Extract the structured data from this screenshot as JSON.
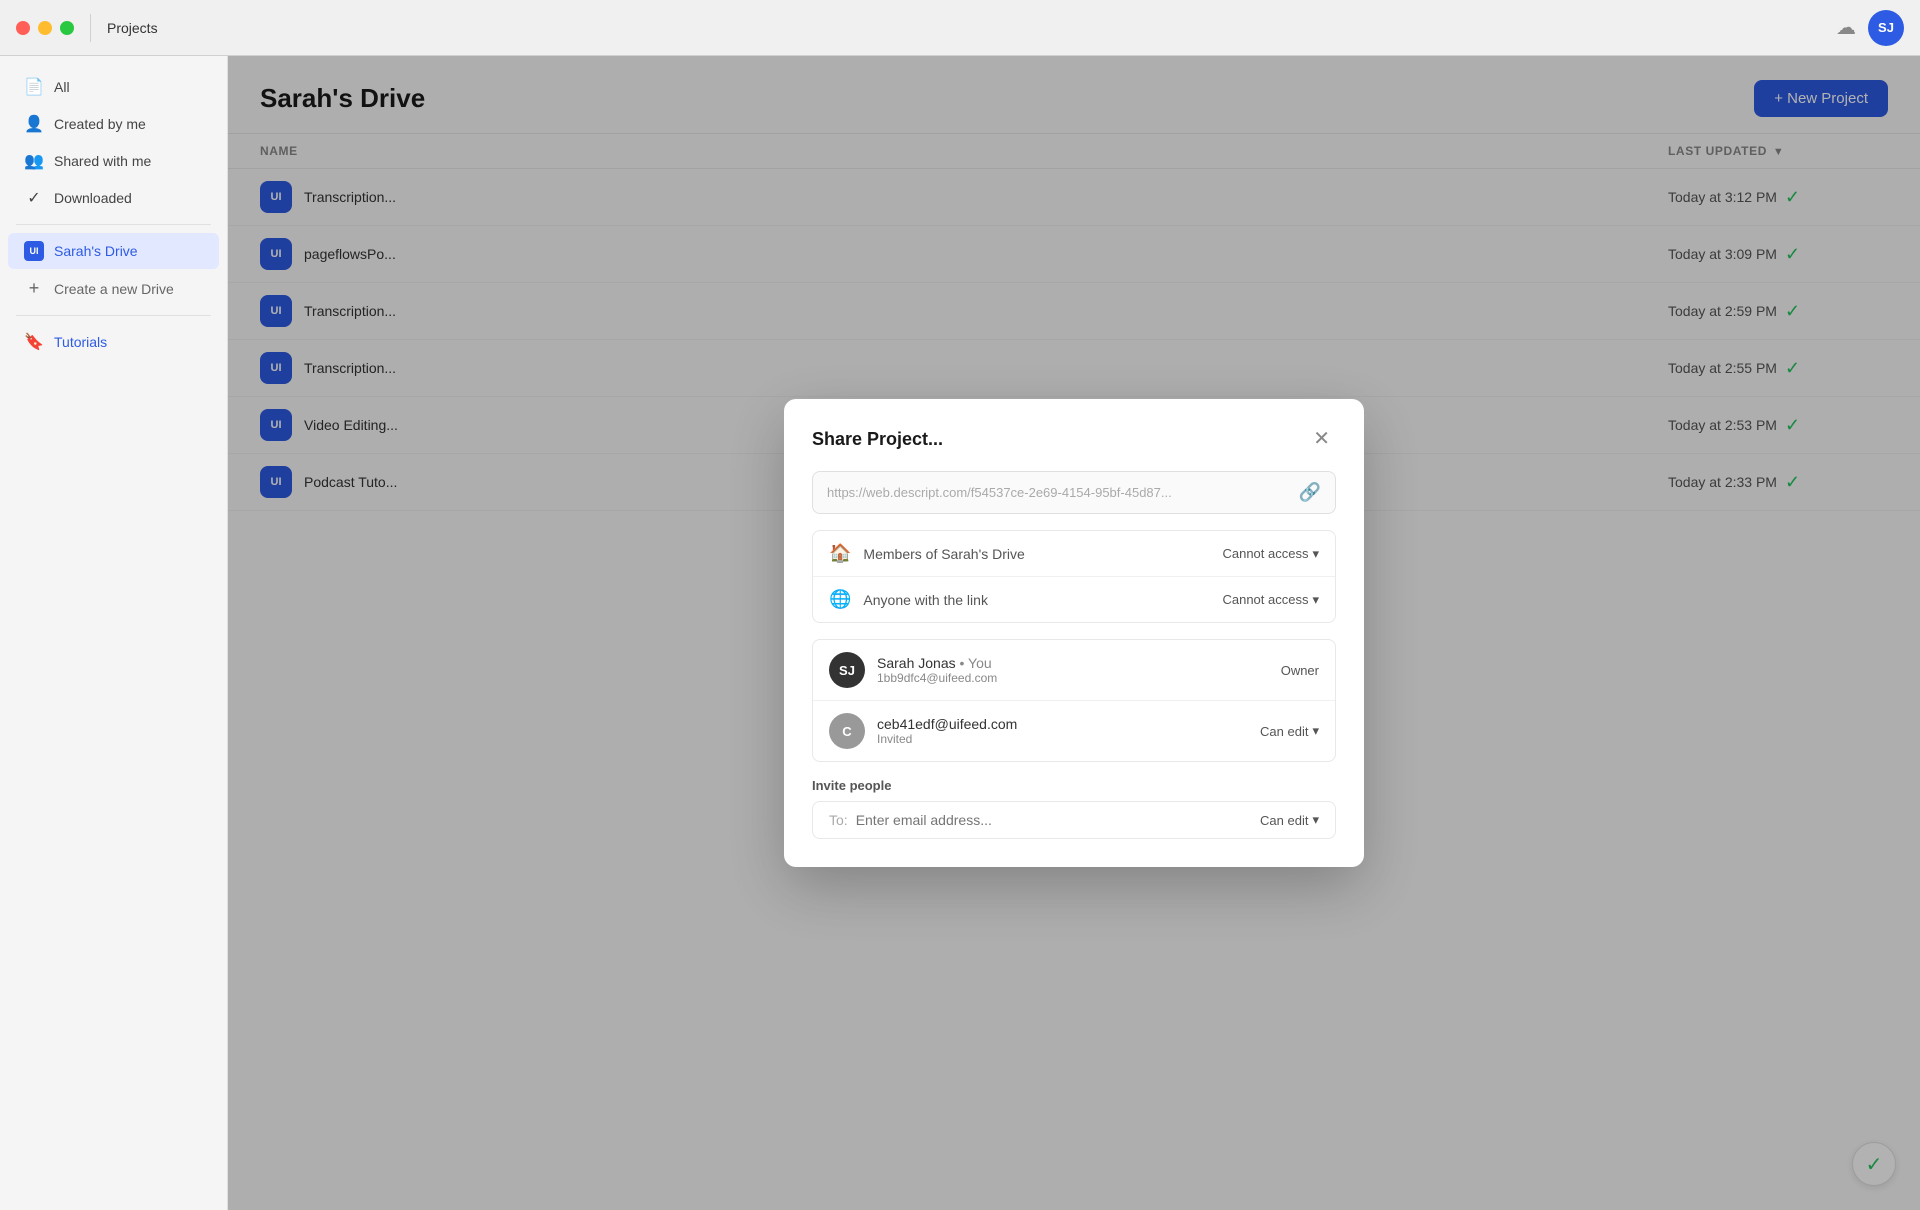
{
  "titlebar": {
    "title": "Projects",
    "avatar_initials": "SJ"
  },
  "sidebar": {
    "items": [
      {
        "id": "all",
        "label": "All",
        "icon": "📄",
        "active": false
      },
      {
        "id": "created-by-me",
        "label": "Created by me",
        "icon": "👤",
        "active": false
      },
      {
        "id": "shared-with-me",
        "label": "Shared with me",
        "icon": "👥",
        "active": false
      },
      {
        "id": "downloaded",
        "label": "Downloaded",
        "icon": "✓",
        "active": false
      }
    ],
    "drives": [
      {
        "id": "sarahs-drive",
        "label": "Sarah's Drive",
        "icon": "UI",
        "active": true
      }
    ],
    "create_drive_label": "Create a new Drive",
    "tutorials_label": "Tutorials"
  },
  "main": {
    "title": "Sarah's Drive",
    "new_project_btn": "+ New Project",
    "table": {
      "col_name": "NAME",
      "col_updated": "LAST UPDATED",
      "rows": [
        {
          "icon": "UI",
          "name": "Transcription...",
          "updated": "Today at 3:12 PM"
        },
        {
          "icon": "UI",
          "name": "pageflowsPo...",
          "updated": "Today at 3:09 PM"
        },
        {
          "icon": "UI",
          "name": "Transcription...",
          "updated": "Today at 2:59 PM"
        },
        {
          "icon": "UI",
          "name": "Transcription...",
          "updated": "Today at 2:55 PM"
        },
        {
          "icon": "UI",
          "name": "Video Editing...",
          "updated": "Today at 2:53 PM"
        },
        {
          "icon": "UI",
          "name": "Podcast Tuto...",
          "updated": "Today at 2:33 PM"
        }
      ]
    }
  },
  "dialog": {
    "title": "Share Project...",
    "link_url": "https://web.descript.com/f54537ce-2e69-4154-95bf-45d87...",
    "access_rows": [
      {
        "icon": "🏠",
        "label": "Members of Sarah's Drive",
        "access": "Cannot access"
      },
      {
        "icon": "🌐",
        "label": "Anyone with the link",
        "access": "Cannot access"
      }
    ],
    "members": [
      {
        "initials": "SJ",
        "avatar_class": "avatar-dark",
        "name": "Sarah Jonas",
        "name_suffix": "• You",
        "email": "1bb9dfc4@uifeed.com",
        "role": "Owner"
      },
      {
        "initials": "C",
        "avatar_class": "avatar-gray",
        "name": "",
        "name_suffix": "",
        "email": "ceb41edf@uifeed.com",
        "sub_label": "Invited",
        "role": "Can edit",
        "role_has_dropdown": true
      }
    ],
    "invite_section": {
      "label": "Invite people",
      "to_label": "To:",
      "placeholder": "Enter email address...",
      "can_edit_label": "Can edit"
    }
  }
}
